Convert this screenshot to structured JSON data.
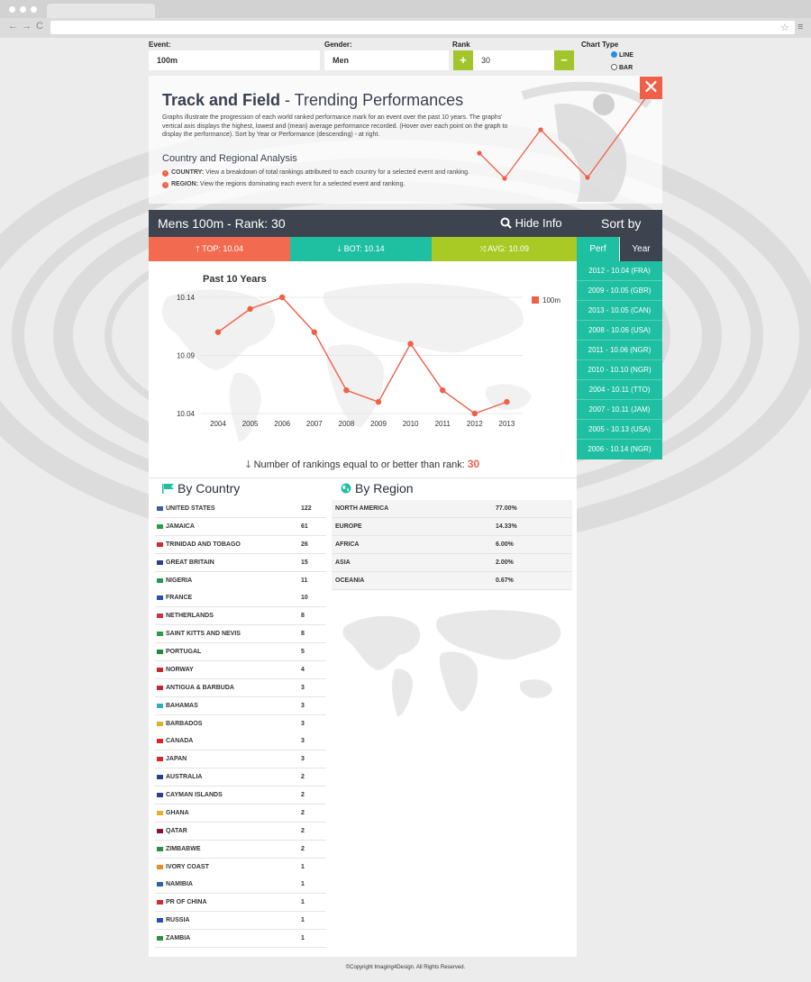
{
  "browser": {
    "nav": [
      "←",
      "→",
      "C"
    ],
    "menu_icon": "hamburger-icon",
    "star_icon": "star-icon"
  },
  "controls": {
    "event": {
      "label": "Event:",
      "value": "100m"
    },
    "gender": {
      "label": "Gender:",
      "value": "Men"
    },
    "rank": {
      "label": "Rank",
      "value": "30",
      "plus": "+",
      "minus": "−"
    },
    "chart_type": {
      "label": "Chart Type",
      "options": [
        "LINE",
        "BAR"
      ],
      "selected": "LINE"
    }
  },
  "info": {
    "title_bold": "Track and Field",
    "title_rest": " - Trending Performances",
    "description": "Graphs illustrate the progression of each world ranked performance mark for an event over the past 10 years. The graphs' vertical axis displays the highest, lowest and (mean) average performance recorded. (Hover over each point on the graph to display the performance). Sort by Year or Performance (descending) - at right.",
    "subtitle": "Country and Regional Analysis",
    "items": [
      {
        "key": "COUNTRY:",
        "text": " View a breakdown of total rankings attributed to each country for a selected event and ranking."
      },
      {
        "key": "REGION:",
        "text": " View the regions dominating each event for a selected event and ranking."
      }
    ],
    "close": "✕"
  },
  "header": {
    "title": "Mens 100m - Rank: 30",
    "hide_info": "Hide Info",
    "sort_by": "Sort by"
  },
  "stats": {
    "top": {
      "label": "TOP: 10.04",
      "color": "#f26b50"
    },
    "bot": {
      "label": "BOT: 10.14",
      "color": "#1fbfa2"
    },
    "avg": {
      "label": "AVG: 10.09",
      "color": "#a9c924"
    }
  },
  "sort_tabs": {
    "perf": "Perf",
    "year": "Year"
  },
  "sort_list": [
    "2012 - 10.04 (FRA)",
    "2009 - 10.05 (GBR)",
    "2013 - 10.05 (CAN)",
    "2008 - 10.06 (USA)",
    "2011 - 10.06 (NGR)",
    "2010 - 10.10 (NGR)",
    "2004 - 10.11 (TTO)",
    "2007 - 10.11 (JAM)",
    "2005 - 10.13 (USA)",
    "2006 - 10.14 (NGR)"
  ],
  "chart_data": {
    "type": "line",
    "title": "Past 10 Years",
    "x": [
      2004,
      2005,
      2006,
      2007,
      2008,
      2009,
      2010,
      2011,
      2012,
      2013
    ],
    "series": [
      {
        "name": "100m",
        "values": [
          10.11,
          10.13,
          10.14,
          10.11,
          10.06,
          10.05,
          10.1,
          10.06,
          10.04,
          10.05
        ],
        "color": "#f06048"
      }
    ],
    "y_ticks": [
      "10.14",
      "10.09",
      "10.04"
    ],
    "ylim": [
      10.04,
      10.14
    ],
    "legend_position": "top-right"
  },
  "rank_summary": {
    "text": "Number of rankings equal to or better than rank:",
    "value": "30"
  },
  "by_country": {
    "title": "By Country",
    "rows": [
      {
        "name": "UNITED STATES",
        "count": "122",
        "flag": "#3c5aa6"
      },
      {
        "name": "JAMAICA",
        "count": "61",
        "flag": "#2e9b46"
      },
      {
        "name": "TRINIDAD AND TOBAGO",
        "count": "26",
        "flag": "#d22b2b"
      },
      {
        "name": "GREAT BRITAIN",
        "count": "15",
        "flag": "#2b3f8c"
      },
      {
        "name": "NIGERIA",
        "count": "11",
        "flag": "#1f9a4a"
      },
      {
        "name": "FRANCE",
        "count": "10",
        "flag": "#2a4fa8"
      },
      {
        "name": "NETHERLANDS",
        "count": "8",
        "flag": "#c8323a"
      },
      {
        "name": "SAINT KITTS AND NEVIS",
        "count": "8",
        "flag": "#2b9b48"
      },
      {
        "name": "PORTUGAL",
        "count": "5",
        "flag": "#1e8b3a"
      },
      {
        "name": "NORWAY",
        "count": "4",
        "flag": "#c42a34"
      },
      {
        "name": "ANTIGUA & BARBUDA",
        "count": "3",
        "flag": "#c8262e"
      },
      {
        "name": "BAHAMAS",
        "count": "3",
        "flag": "#2bb0c0"
      },
      {
        "name": "BARBADOS",
        "count": "3",
        "flag": "#e0b020"
      },
      {
        "name": "CANADA",
        "count": "3",
        "flag": "#d62a2a"
      },
      {
        "name": "JAPAN",
        "count": "3",
        "flag": "#d62a2a"
      },
      {
        "name": "AUSTRALIA",
        "count": "2",
        "flag": "#2b3f8c"
      },
      {
        "name": "CAYMAN ISLANDS",
        "count": "2",
        "flag": "#2b3f8c"
      },
      {
        "name": "GHANA",
        "count": "2",
        "flag": "#e8b020"
      },
      {
        "name": "QATAR",
        "count": "2",
        "flag": "#8a1538"
      },
      {
        "name": "ZIMBABWE",
        "count": "2",
        "flag": "#2c8f3e"
      },
      {
        "name": "IVORY COAST",
        "count": "1",
        "flag": "#f08a20"
      },
      {
        "name": "NAMIBIA",
        "count": "1",
        "flag": "#2a62b0"
      },
      {
        "name": "PR OF CHINA",
        "count": "1",
        "flag": "#d62a2a"
      },
      {
        "name": "RUSSIA",
        "count": "1",
        "flag": "#2a4fa8"
      },
      {
        "name": "ZAMBIA",
        "count": "1",
        "flag": "#2b8f3c"
      }
    ]
  },
  "by_region": {
    "title": "By Region",
    "rows": [
      {
        "name": "NORTH AMERICA",
        "pct": "77.00%"
      },
      {
        "name": "EUROPE",
        "pct": "14.33%"
      },
      {
        "name": "AFRICA",
        "pct": "6.00%"
      },
      {
        "name": "ASIA",
        "pct": "2.00%"
      },
      {
        "name": "OCEANIA",
        "pct": "0.67%"
      }
    ]
  },
  "footer": {
    "copyright": "©Copyright Imaging4Design. All Rights Reserved."
  }
}
